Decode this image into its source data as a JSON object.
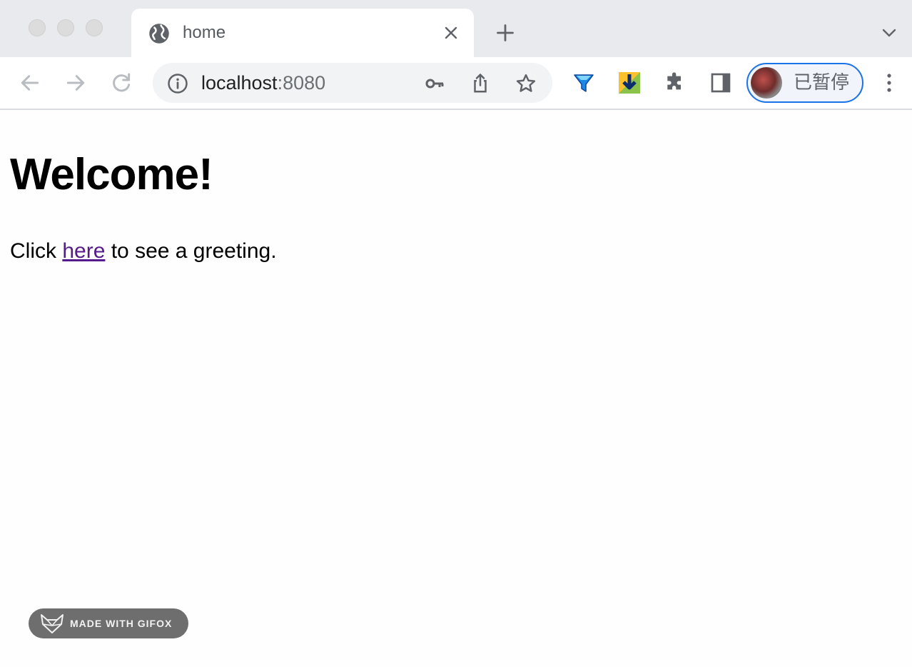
{
  "browser": {
    "tab": {
      "title": "home"
    },
    "address_bar": {
      "host": "localhost",
      "port": ":8080"
    },
    "profile": {
      "label": "已暂停"
    },
    "icons": {
      "favicon": "globe-icon",
      "tab_close": "close-icon",
      "new_tab": "plus-icon",
      "tab_search": "chevron-down-icon",
      "back": "arrow-left-icon",
      "forward": "arrow-right-icon",
      "reload": "reload-icon",
      "site_info": "info-icon",
      "passwords": "key-icon",
      "share": "share-icon",
      "bookmark": "star-icon",
      "extensions": [
        "funnel-extension-icon",
        "download-extension-icon",
        "puzzle-icon",
        "side-panel-icon"
      ],
      "menu": "kebab-menu-icon"
    },
    "colors": {
      "accent": "#1a73e8",
      "titlebar": "#e9eaed",
      "omnibox": "#f1f3f4"
    }
  },
  "page": {
    "heading": "Welcome!",
    "message_before": "Click ",
    "link_text": "here",
    "message_after": " to see a greeting.",
    "link_color": "#551a8b"
  },
  "watermark": {
    "text": "MADE WITH GIFOX"
  }
}
